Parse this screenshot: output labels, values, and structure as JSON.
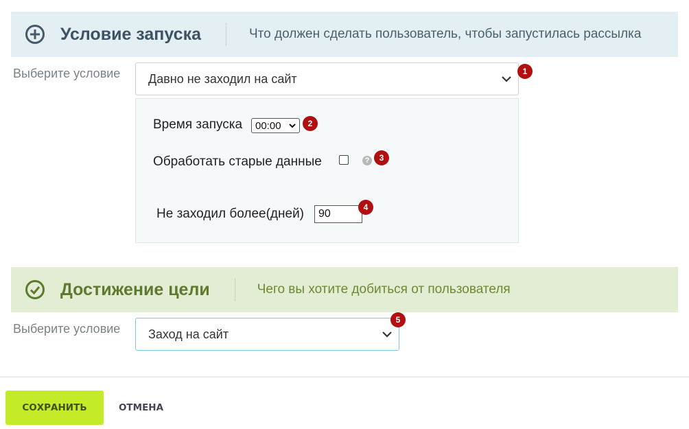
{
  "launch": {
    "icon": "plus-circle-icon",
    "title": "Условие запуска",
    "subtitle": "Что должен сделать пользователь, чтобы запустилась рассылка",
    "condition_label": "Выберите условие",
    "condition_value": "Давно не заходил на сайт",
    "badge": "1",
    "settings": {
      "time_label": "Время запуска",
      "time_value": "00:00",
      "time_badge": "2",
      "process_old_label": "Обработать старые данные",
      "process_old_checked": false,
      "process_old_badge": "3",
      "help_icon": "question-circle-icon",
      "help_glyph": "?",
      "days_label": "Не заходил более(дней)",
      "days_value": "90",
      "days_badge": "4"
    }
  },
  "goal": {
    "icon": "check-circle-icon",
    "title": "Достижение цели",
    "subtitle": "Чего вы хотите добиться от пользователя",
    "condition_label": "Выберите условие",
    "condition_value": "Заход на сайт",
    "badge": "5"
  },
  "footer": {
    "save_label": "СОХРАНИТЬ",
    "cancel_label": "ОТМЕНА"
  },
  "colors": {
    "launch_header_bg": "#e4eff4",
    "goal_header_bg": "#e3edd3",
    "badge": "#b01010",
    "save_button": "#c4eb27",
    "active_border": "#7cc6e8"
  }
}
